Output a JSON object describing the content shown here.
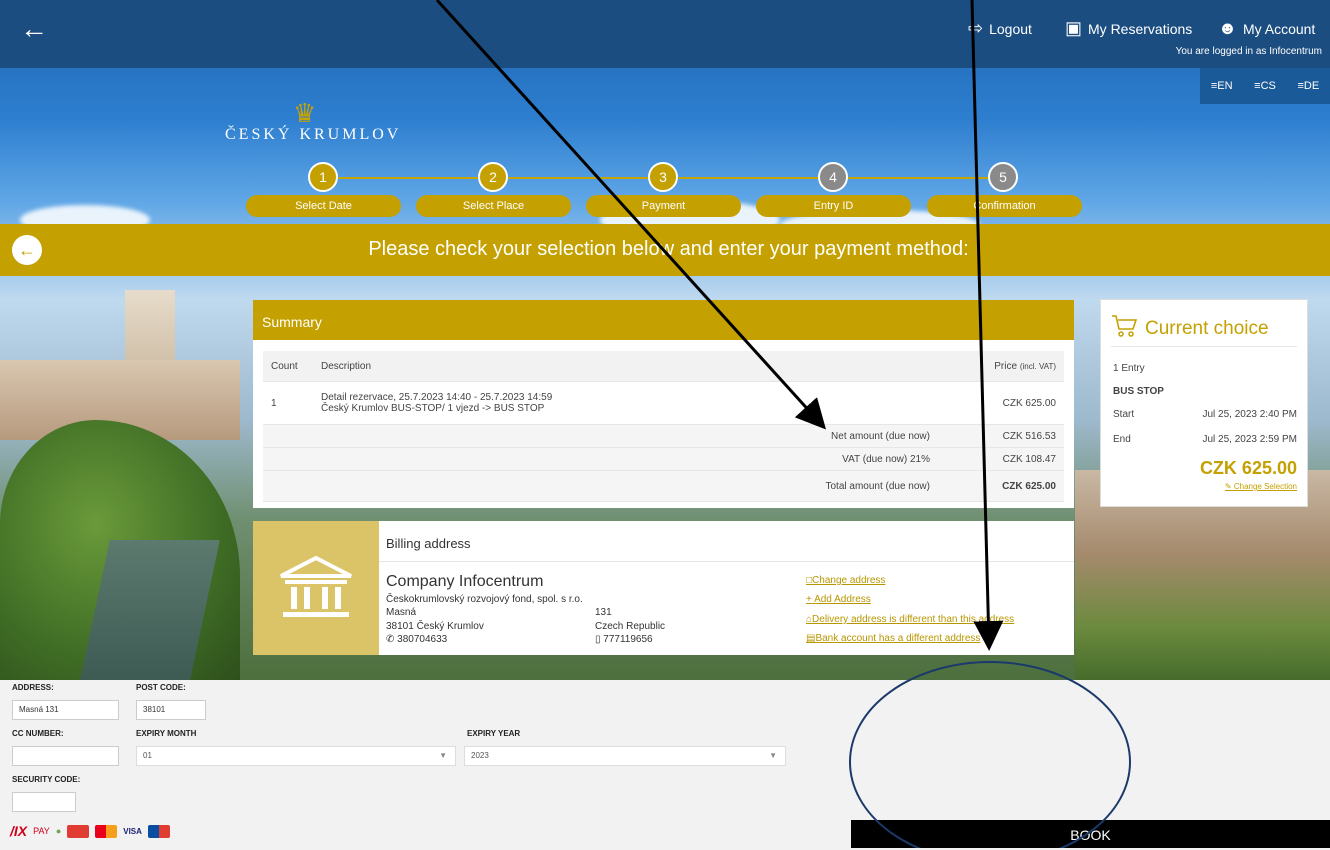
{
  "topbar": {
    "logout": "Logout",
    "reservations": "My Reservations",
    "account": "My Account",
    "logged_in": "You are logged in as Infocentrum"
  },
  "languages": [
    "EN",
    "CS",
    "DE"
  ],
  "logo": {
    "name": "ČESKÝ KRUMLOV"
  },
  "steps": [
    {
      "num": "1",
      "label": "Select Date"
    },
    {
      "num": "2",
      "label": "Select Place"
    },
    {
      "num": "3",
      "label": "Payment"
    },
    {
      "num": "4",
      "label": "Entry ID"
    },
    {
      "num": "5",
      "label": "Confirmation"
    }
  ],
  "banner": {
    "text": "Please check your selection below and enter your payment method:"
  },
  "summary": {
    "title": "Summary",
    "headers": {
      "count": "Count",
      "description": "Description",
      "price": "Price",
      "price_note": "(incl. VAT)"
    },
    "row": {
      "count": "1",
      "line1": "Detail rezervace, 25.7.2023 14:40 - 25.7.2023 14:59",
      "line2": "Český Krumlov BUS-STOP/ 1 vjezd -> BUS STOP",
      "price": "CZK 625.00"
    },
    "net_label": "Net amount (due now)",
    "net_value": "CZK 516.53",
    "vat_label": "VAT (due now) 21%",
    "vat_value": "CZK 108.47",
    "total_label": "Total amount (due now)",
    "total_value": "CZK 625.00"
  },
  "choice": {
    "title": "Current choice",
    "entries": "1 Entry",
    "place": "BUS STOP",
    "start_label": "Start",
    "start_value": "Jul 25, 2023 2:40 PM",
    "end_label": "End",
    "end_value": "Jul 25, 2023 2:59 PM",
    "total": "CZK 625.00",
    "change": "Change Selection"
  },
  "billing": {
    "title": "Billing address",
    "company": "Company Infocentrum",
    "fund": "Českokrumlovský rozvojový fond, spol. s r.o.",
    "street": "Masná",
    "number": "131",
    "city": "38101 Český Krumlov",
    "country": "Czech Republic",
    "phone": "380704633",
    "mobile": "777119656",
    "links": {
      "change": "Change address",
      "add": "Add Address",
      "delivery": "Delivery address is different than this address",
      "bank": "Bank account has a different address"
    }
  },
  "form": {
    "address_label": "ADDRESS:",
    "address_value": "Masná 131",
    "postcode_label": "POST CODE:",
    "postcode_value": "38101",
    "cc_label": "CC NUMBER:",
    "cc_value": "",
    "month_label": "EXPIRY MONTH",
    "month_value": "01",
    "year_label": "EXPIRY YEAR",
    "year_value": "2023",
    "security_label": "SECURITY CODE:",
    "security_value": "",
    "book": "BOOK",
    "pay_brand": "PAY",
    "visa": "VISA"
  }
}
